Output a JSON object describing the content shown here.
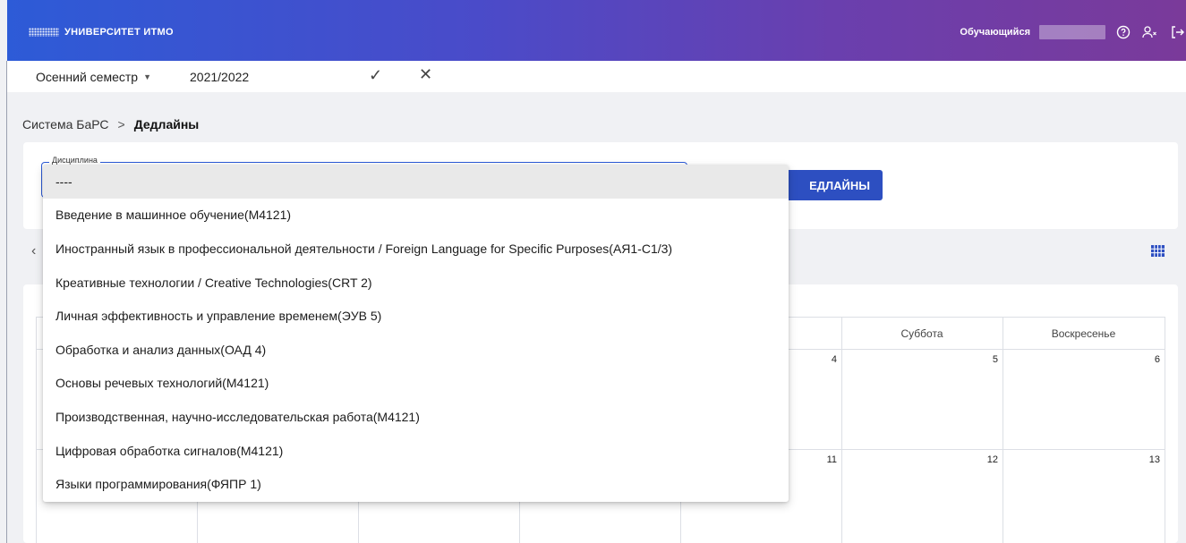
{
  "header": {
    "logo_text": "УНИВЕРСИТЕТ ИТМО",
    "role_label": "Обучающийся",
    "icons": [
      "help-icon",
      "user-switch-icon",
      "logout-icon"
    ]
  },
  "semester": {
    "term": "Осенний семестр",
    "year": "2021/2022"
  },
  "breadcrumb": {
    "root": "Система БаРС",
    "separator": ">",
    "current": "Дедлайны"
  },
  "filter": {
    "field_label": "Дисциплина",
    "show_button_label": "ЕДЛАЙНЫ"
  },
  "calendar": {
    "visible_headers": [
      "Суббота",
      "Воскресенье"
    ],
    "row1_days": [
      "4",
      "5",
      "6"
    ],
    "row2_days": [
      "11",
      "12",
      "13"
    ]
  },
  "dropdown": {
    "options": [
      "----",
      "Введение в машинное обучение(M4121)",
      "Иностранный язык в профессиональной деятельности / Foreign Language for Specific Purposes(АЯ1-С1/3)",
      "Креативные технологии / Creative Technologies(CRT 2)",
      "Личная эффективность и управление временем(ЭУВ 5)",
      "Обработка и анализ данных(ОАД 4)",
      "Основы речевых технологий(M4121)",
      "Производственная, научно-исследовательская работа(M4121)",
      "Цифровая обработка сигналов(M4121)",
      "Языки программирования(ФЯПР 1)"
    ],
    "selected_index": 0
  },
  "colors": {
    "header_start": "#2d5bd7",
    "header_end": "#7a3a9a",
    "accent": "#2d4fc1"
  }
}
